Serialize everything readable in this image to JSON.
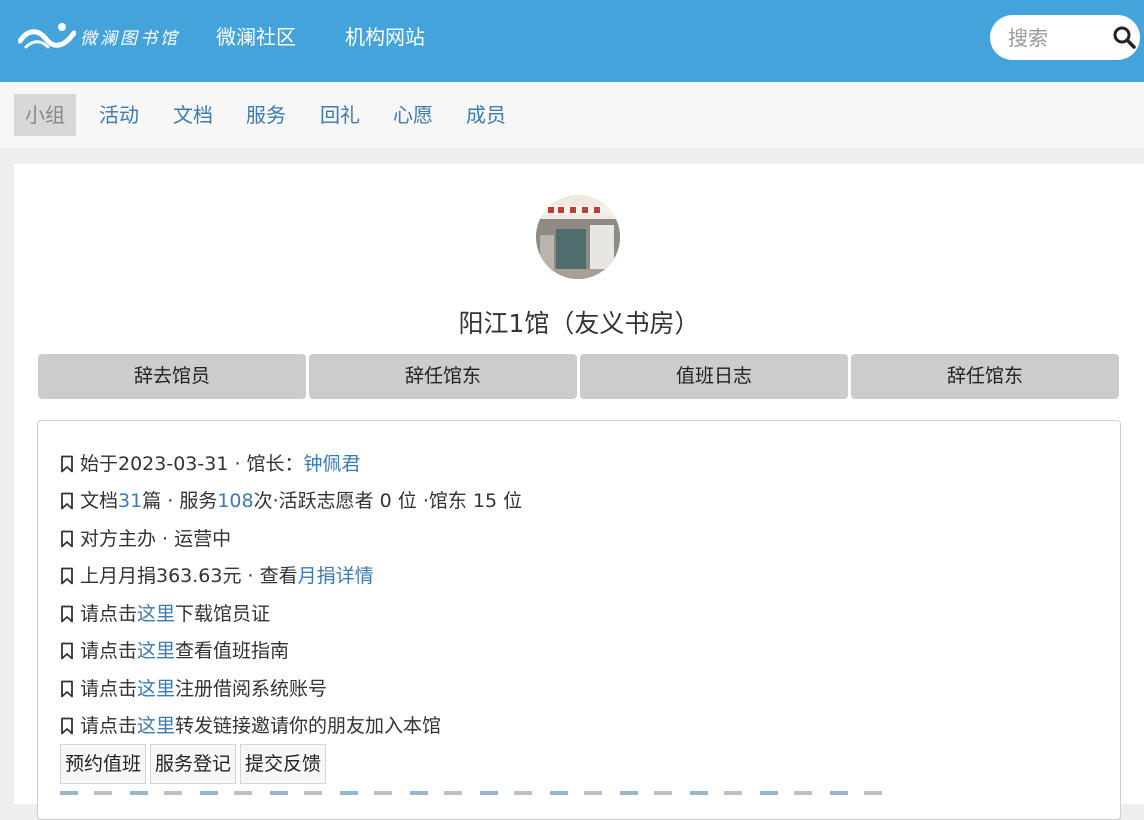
{
  "header": {
    "logo_text": "微澜图书馆",
    "nav": [
      "微澜社区",
      "机构网站"
    ],
    "search_placeholder": "搜索"
  },
  "tabs": [
    {
      "label": "小组",
      "active": true
    },
    {
      "label": "活动",
      "active": false
    },
    {
      "label": "文档",
      "active": false
    },
    {
      "label": "服务",
      "active": false
    },
    {
      "label": "回礼",
      "active": false
    },
    {
      "label": "心愿",
      "active": false
    },
    {
      "label": "成员",
      "active": false
    }
  ],
  "group": {
    "title": "阳江1馆（友义书房）",
    "actions": [
      "辞去馆员",
      "辞任馆东",
      "值班日志",
      "辞任馆东"
    ]
  },
  "info": {
    "line1": {
      "prefix": "始于2023-03-31 · 馆长：",
      "curator": "钟佩君"
    },
    "line2": {
      "t1": "文档 ",
      "docs": "31",
      "t2": " 篇 · 服务 ",
      "services": "108",
      "t3": " 次·活跃志愿者 0 位 ·馆东 15 位"
    },
    "line3": "对方主办 · 运营中",
    "line4": {
      "prefix": "上月月捐363.63元 · 查看",
      "link": "月捐详情"
    },
    "line5": {
      "prefix": "请点击",
      "link": "这里",
      "suffix": "下载馆员证"
    },
    "line6": {
      "prefix": "请点击",
      "link": "这里",
      "suffix": "查看值班指南"
    },
    "line7": {
      "prefix": "请点击",
      "link": "这里",
      "suffix": "注册借阅系统账号"
    },
    "line8": {
      "prefix": "请点击",
      "link": "这里",
      "suffix": "转发链接邀请你的朋友加入本馆"
    }
  },
  "buttons": [
    "预约值班",
    "服务登记",
    "提交反馈"
  ],
  "colors": {
    "header": "#45a3dc",
    "link": "#3d7ab0",
    "button": "#cccccc"
  }
}
